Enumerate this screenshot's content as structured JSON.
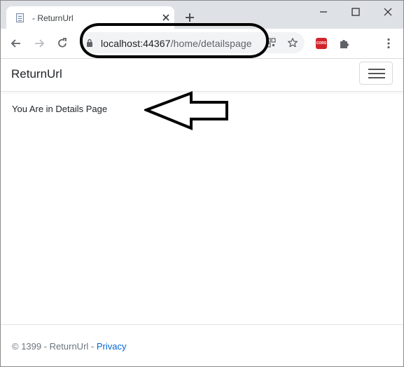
{
  "browser": {
    "tab": {
      "title": "- ReturnUrl",
      "favicon": "page-icon"
    },
    "url": {
      "host": "localhost:44367",
      "path": "/home/detailspage"
    },
    "extensions": {
      "cors_label": "CORS"
    }
  },
  "page": {
    "brand": "ReturnUrl",
    "content": "You Are in Details Page",
    "footer": {
      "copyright": "© 1399 - ReturnUrl - ",
      "privacy_link": "Privacy"
    }
  },
  "colors": {
    "tabstrip": "#dee1e6",
    "omnibox": "#f1f3f4",
    "link": "#0366d6",
    "annotation": "#000000"
  }
}
